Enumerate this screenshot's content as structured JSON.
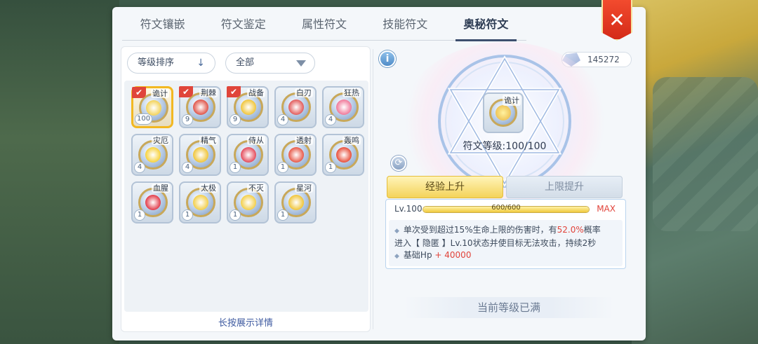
{
  "tabs": [
    {
      "label": "符文镶嵌"
    },
    {
      "label": "符文鉴定"
    },
    {
      "label": "属性符文"
    },
    {
      "label": "技能符文"
    },
    {
      "label": "奥秘符文"
    }
  ],
  "active_tab": "奥秘符文",
  "close_label": "✕",
  "toolbar": {
    "sort_label": "等级排序",
    "sort_arrow": "↓",
    "filter_label": "全部"
  },
  "runes": [
    {
      "name": "诡计",
      "level": "100",
      "checked": true,
      "selected": true,
      "color": "#f3d35a"
    },
    {
      "name": "荆棘",
      "level": "9",
      "checked": true,
      "selected": false,
      "color": "#e0554a"
    },
    {
      "name": "战备",
      "level": "9",
      "checked": true,
      "selected": false,
      "color": "#f0c53a"
    },
    {
      "name": "白刃",
      "level": "4",
      "checked": false,
      "selected": false,
      "color": "#e25c5c"
    },
    {
      "name": "狂热",
      "level": "4",
      "checked": false,
      "selected": false,
      "color": "#f07a9a"
    },
    {
      "name": "灾厄",
      "level": "4",
      "checked": false,
      "selected": false,
      "color": "#f7d23c"
    },
    {
      "name": "精气",
      "level": "4",
      "checked": false,
      "selected": false,
      "color": "#f0c53a"
    },
    {
      "name": "侍从",
      "level": "1",
      "checked": false,
      "selected": false,
      "color": "#e44c5c"
    },
    {
      "name": "透射",
      "level": "1",
      "checked": false,
      "selected": false,
      "color": "#e85a4a"
    },
    {
      "name": "轰鸣",
      "level": "1",
      "checked": false,
      "selected": false,
      "color": "#e8503c"
    },
    {
      "name": "血腥",
      "level": "1",
      "checked": false,
      "selected": false,
      "color": "#e23c4a"
    },
    {
      "name": "太极",
      "level": "1",
      "checked": false,
      "selected": false,
      "color": "#f3cf4a"
    },
    {
      "name": "不灭",
      "level": "1",
      "checked": false,
      "selected": false,
      "color": "#f3cf4a"
    },
    {
      "name": "星河",
      "level": "1",
      "checked": false,
      "selected": false,
      "color": "#f0c53a"
    }
  ],
  "check_mark": "✔",
  "hint": "长按展示详情",
  "info_icon_label": "i",
  "currency": {
    "amount": "145272"
  },
  "detail": {
    "rune_name": "诡计",
    "rune_level_label": "符文等级:100/100",
    "btn_exp": "经验上升",
    "btn_limit": "上限提升",
    "lv": "Lv.100",
    "exp_text": "600/600",
    "exp_fraction": 1.0,
    "max": "MAX",
    "desc1_a": "单次受到超过15%生命上限的伤害时，有",
    "desc1_hl": "52.0%",
    "desc1_b": "概率",
    "desc1_c": "进入【 隐匿 】Lv.10状态并使目标无法攻击，持续2秒",
    "desc2_a": "基础Hp",
    "desc2_hl": "+ 40000",
    "max_level_text": "当前等级已满"
  }
}
